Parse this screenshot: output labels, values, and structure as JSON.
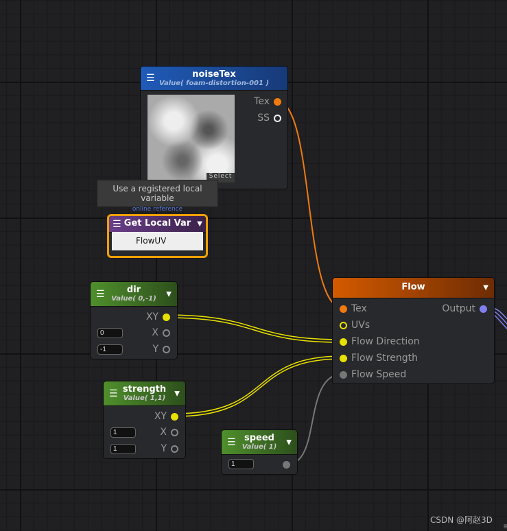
{
  "noise_tex": {
    "title": "noiseTex",
    "subtitle": "Value( foam-distortion-001 )",
    "select_label": "Select",
    "ports": [
      "Tex",
      "SS"
    ]
  },
  "tooltip": {
    "text": "Use a registered local variable",
    "link": "online reference"
  },
  "get_local_var": {
    "title": "Get Local Var",
    "value": "FlowUV"
  },
  "dir": {
    "title": "dir",
    "subtitle": "Value( 0,-1)",
    "out": "XY",
    "x_label": "X",
    "y_label": "Y",
    "x": "0",
    "y": "-1"
  },
  "strength": {
    "title": "strength",
    "subtitle": "Value( 1,1)",
    "out": "XY",
    "x_label": "X",
    "y_label": "Y",
    "x": "1",
    "y": "1"
  },
  "speed": {
    "title": "speed",
    "subtitle": "Value( 1)",
    "value": "1"
  },
  "flow": {
    "title": "Flow",
    "inputs": [
      "Tex",
      "UVs",
      "Flow Direction",
      "Flow Strength",
      "Flow Speed"
    ],
    "output": "Output"
  },
  "watermark": "CSDN @阿赵3D",
  "colors": {
    "texture": "#f07a10",
    "vector2": "#e8e000",
    "float": "#777777",
    "output": "#7f7ff0",
    "flow_header": "#d45a00",
    "value_header": "#4f8f2c",
    "local_var_header": "#6a3f8a",
    "selection": "#f0a000"
  }
}
